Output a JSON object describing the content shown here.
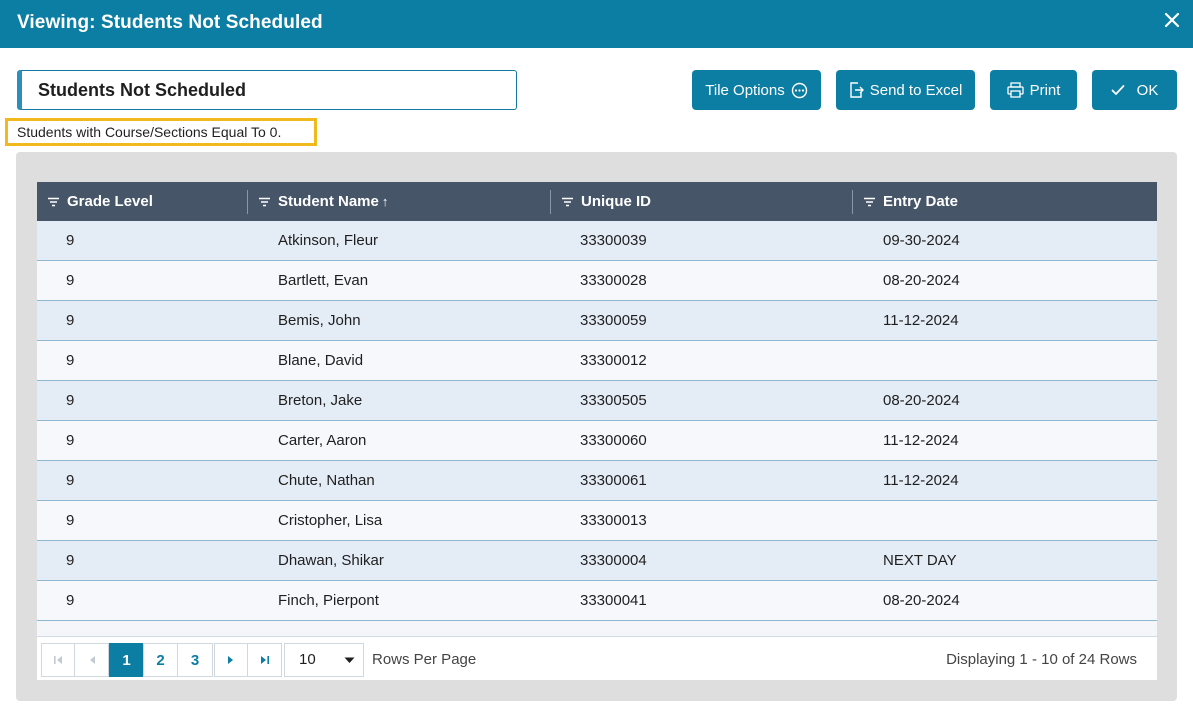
{
  "window": {
    "title": "Viewing: Students Not Scheduled"
  },
  "report_name": {
    "value": "Students Not Scheduled"
  },
  "toolbar": {
    "tile_options_label": "Tile Options",
    "send_to_excel_label": "Send to Excel",
    "print_label": "Print",
    "ok_label": "OK"
  },
  "filter_note": "Students with Course/Sections Equal To 0.",
  "grid": {
    "columns": [
      "Grade Level",
      "Student Name",
      "Unique ID",
      "Entry Date"
    ],
    "sort_indicator": "↑",
    "rows": [
      [
        "9",
        "Atkinson, Fleur",
        "33300039",
        "09-30-2024"
      ],
      [
        "9",
        "Bartlett, Evan",
        "33300028",
        "08-20-2024"
      ],
      [
        "9",
        "Bemis, John",
        "33300059",
        "11-12-2024"
      ],
      [
        "9",
        "Blane, David",
        "33300012",
        ""
      ],
      [
        "9",
        "Breton, Jake",
        "33300505",
        "08-20-2024"
      ],
      [
        "9",
        "Carter, Aaron",
        "33300060",
        "11-12-2024"
      ],
      [
        "9",
        "Chute, Nathan",
        "33300061",
        "11-12-2024"
      ],
      [
        "9",
        "Cristopher, Lisa",
        "33300013",
        ""
      ],
      [
        "9",
        "Dhawan, Shikar",
        "33300004",
        "NEXT DAY"
      ],
      [
        "9",
        "Finch, Pierpont",
        "33300041",
        "08-20-2024"
      ]
    ]
  },
  "pager": {
    "pages": [
      "1",
      "2",
      "3"
    ],
    "current_page": "1",
    "rows_per_page": "10",
    "rows_per_page_label": "Rows Per Page",
    "display_text": "Displaying 1 - 10 of 24 Rows"
  },
  "colors": {
    "header_bar": "#0d7ea3",
    "grid_header": "#465568",
    "filter_highlight": "#f2b91e",
    "row_alt": "#e4ecf6"
  },
  "icons": [
    "close-icon",
    "more-circle-icon",
    "export-icon",
    "printer-icon",
    "check-icon",
    "filter-icon",
    "first-page-icon",
    "prev-page-icon",
    "next-page-icon",
    "last-page-icon",
    "chevron-down-icon"
  ]
}
